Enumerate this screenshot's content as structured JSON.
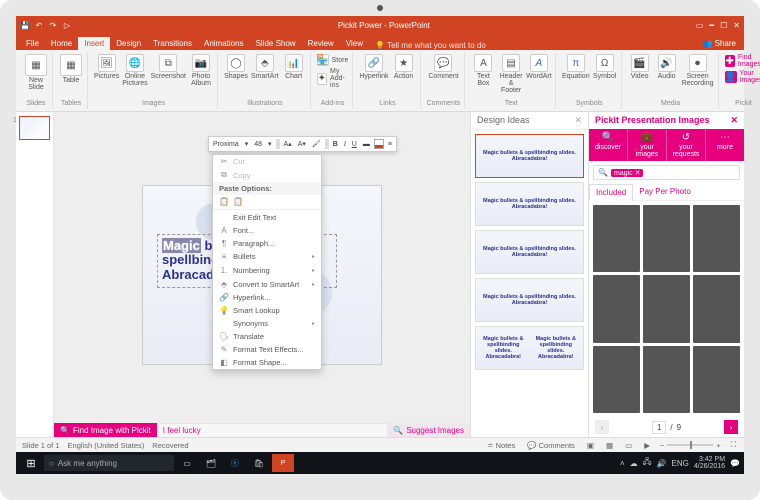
{
  "window": {
    "title": "Pickit Power - PowerPoint"
  },
  "tabs": {
    "file": "File",
    "home": "Home",
    "insert": "Insert",
    "design": "Design",
    "transitions": "Transitions",
    "animations": "Animations",
    "slideshow": "Slide Show",
    "review": "Review",
    "view": "View",
    "tellme": "Tell me what you want to do",
    "share": "Share"
  },
  "ribbon": {
    "slides": {
      "label": "Slides",
      "newslide": "New\nSlide"
    },
    "tables": {
      "label": "Tables",
      "table": "Table"
    },
    "images": {
      "label": "Images",
      "pictures": "Pictures",
      "online": "Online\nPictures",
      "screenshot": "Screenshot",
      "album": "Photo\nAlbum"
    },
    "illus": {
      "label": "Illustrations",
      "shapes": "Shapes",
      "smartart": "SmartArt",
      "chart": "Chart"
    },
    "addins": {
      "label": "Add-ins",
      "store": "Store",
      "myaddins": "My Add-ins"
    },
    "links": {
      "label": "Links",
      "hyperlink": "Hyperlink",
      "action": "Action"
    },
    "comments": {
      "label": "Comments",
      "comment": "Comment"
    },
    "text": {
      "label": "Text",
      "textbox": "Text\nBox",
      "header": "Header\n& Footer",
      "wordart": "WordArt"
    },
    "symbols": {
      "label": "Symbols",
      "equation": "Equation",
      "symbol": "Symbol"
    },
    "media": {
      "label": "Media",
      "video": "Video",
      "audio": "Audio",
      "screenrec": "Screen\nRecording"
    },
    "pickit": {
      "label": "Pickit",
      "find": "Find Images",
      "your": "Your Images"
    }
  },
  "slide": {
    "text_hl": "Magic",
    "text_rest": " bullets & spellbinding slides. Abracadabra!"
  },
  "minibar": {
    "font": "Proxima",
    "size": "48"
  },
  "ctx": {
    "cut": "Cut",
    "copy": "Copy",
    "pasteopt": "Paste Options:",
    "exitedit": "Exit Edit Text",
    "font": "Font...",
    "paragraph": "Paragraph...",
    "bullets": "Bullets",
    "numbering": "Numbering",
    "smartart": "Convert to SmartArt",
    "hyperlink": "Hyperlink...",
    "smartlookup": "Smart Lookup",
    "synonyms": "Synonyms",
    "translate": "Translate",
    "texteffects": "Format Text Effects...",
    "formatshape": "Format Shape..."
  },
  "design": {
    "title": "Design Ideas",
    "txt": "Magic bullets & spellbinding slides. Abracadabra!"
  },
  "pickit": {
    "title": "Pickit Presentation Images",
    "tabs": {
      "discover": "discover",
      "yourimages": "your images",
      "yourrequests": "your requests",
      "more": "more"
    },
    "search_tag": "magic",
    "subtabs": {
      "included": "Included",
      "pay": "Pay Per Photo"
    },
    "page": "1",
    "total": "9"
  },
  "pickitbar": {
    "find": "Find Image with Pickit",
    "lucky": "I feel lucky",
    "suggest": "Suggest Images"
  },
  "status": {
    "slide": "Slide 1 of 1",
    "lang": "English (United States)",
    "recovered": "Recovered",
    "notes": "Notes",
    "comments": "Comments"
  },
  "taskbar": {
    "cortana": "Ask me anything",
    "lang": "ENG",
    "time": "3:42 PM",
    "date": "4/26/2016"
  }
}
